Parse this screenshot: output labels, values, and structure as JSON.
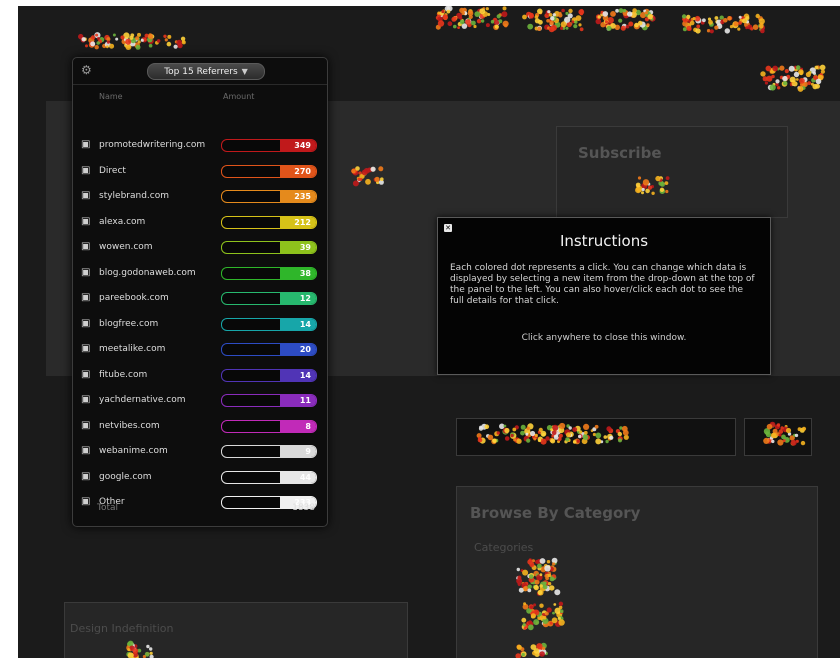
{
  "referrers_panel": {
    "dropdown_label": "Top 15 Referrers",
    "col_name": "Name",
    "col_amount": "Amount",
    "rows": [
      {
        "name": "promotedwritering.com",
        "value": "349",
        "color": "#c0191b"
      },
      {
        "name": "Direct",
        "value": "270",
        "color": "#e0541a"
      },
      {
        "name": "stylebrand.com",
        "value": "235",
        "color": "#e58a1c"
      },
      {
        "name": "alexa.com",
        "value": "212",
        "color": "#d6c218"
      },
      {
        "name": "wowen.com",
        "value": "39",
        "color": "#8ec21c"
      },
      {
        "name": "blog.godonaweb.com",
        "value": "38",
        "color": "#2fb62a"
      },
      {
        "name": "pareebook.com",
        "value": "12",
        "color": "#27b86e"
      },
      {
        "name": "blogfree.com",
        "value": "14",
        "color": "#17a6a9"
      },
      {
        "name": "meetalike.com",
        "value": "20",
        "color": "#2d4cc4"
      },
      {
        "name": "fitube.com",
        "value": "14",
        "color": "#5034b6"
      },
      {
        "name": "yachdernative.com",
        "value": "11",
        "color": "#8a2cbc"
      },
      {
        "name": "netvibes.com",
        "value": "8",
        "color": "#c12ab8"
      },
      {
        "name": "webanime.com",
        "value": "9",
        "color": "#d9d9d9"
      },
      {
        "name": "google.com",
        "value": "44",
        "color": "#e6e6e6"
      },
      {
        "name": "Other",
        "value": "233",
        "color": "#f0f0f0"
      }
    ],
    "total_label": "Total",
    "total_value": "1838"
  },
  "instructions": {
    "title": "Instructions",
    "body": "Each colored dot represents a click. You can change which data is displayed by selecting a new item from the drop-down at the top of the panel to the left. You can also hover/click each dot to see the full details for that click.",
    "dismiss": "Click anywhere to close this window."
  },
  "background": {
    "sidebar_heading": "Subscribe",
    "categories_heading": "Browse By Category",
    "categories_sub": "Categories",
    "sidebar_footer": "Design Indefinition"
  }
}
